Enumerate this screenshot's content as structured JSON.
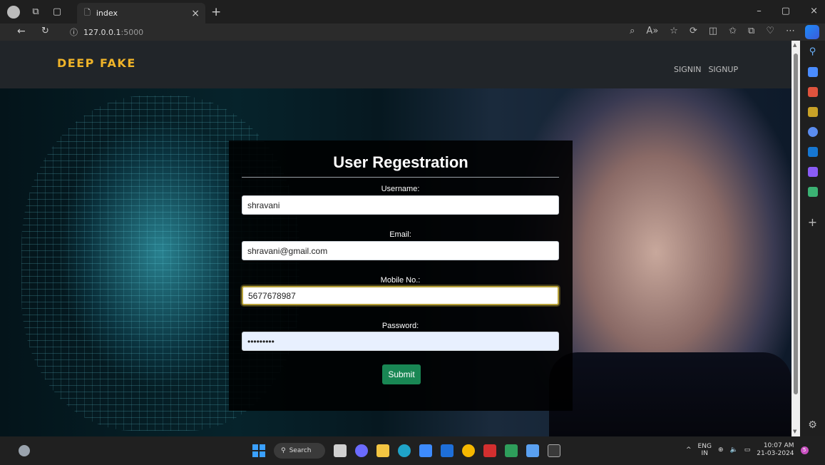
{
  "browser": {
    "tab_title": "index",
    "url_host": "127.0.0.1",
    "url_port": ":5000"
  },
  "navbar": {
    "brand": "DEEP FAKE",
    "links": [
      "SIGNIN",
      "SIGNUP"
    ]
  },
  "form": {
    "title": "User Regestration",
    "fields": [
      {
        "label": "Username:",
        "value": "shravani"
      },
      {
        "label": "Email:",
        "value": "shravani@gmail.com"
      },
      {
        "label": "Mobile No.:",
        "value": "5677678987"
      },
      {
        "label": "Password:",
        "value": "•••••••••"
      }
    ],
    "submit_label": "Submit"
  },
  "taskbar": {
    "search_label": "Search",
    "lang_line1": "ENG",
    "lang_line2": "IN",
    "time": "10:07 AM",
    "date": "21-03-2024",
    "notification_count": "5"
  },
  "colors": {
    "brand": "#f0b429",
    "submit": "#198754",
    "navbar_bg": "#212529"
  },
  "icons": [
    "profile-avatar",
    "workspaces-icon",
    "tab-actions-icon",
    "page-icon",
    "close-icon",
    "plus-icon",
    "back-icon",
    "refresh-icon",
    "info-icon",
    "search-icon",
    "settings-icon",
    "windows-start-icon"
  ]
}
